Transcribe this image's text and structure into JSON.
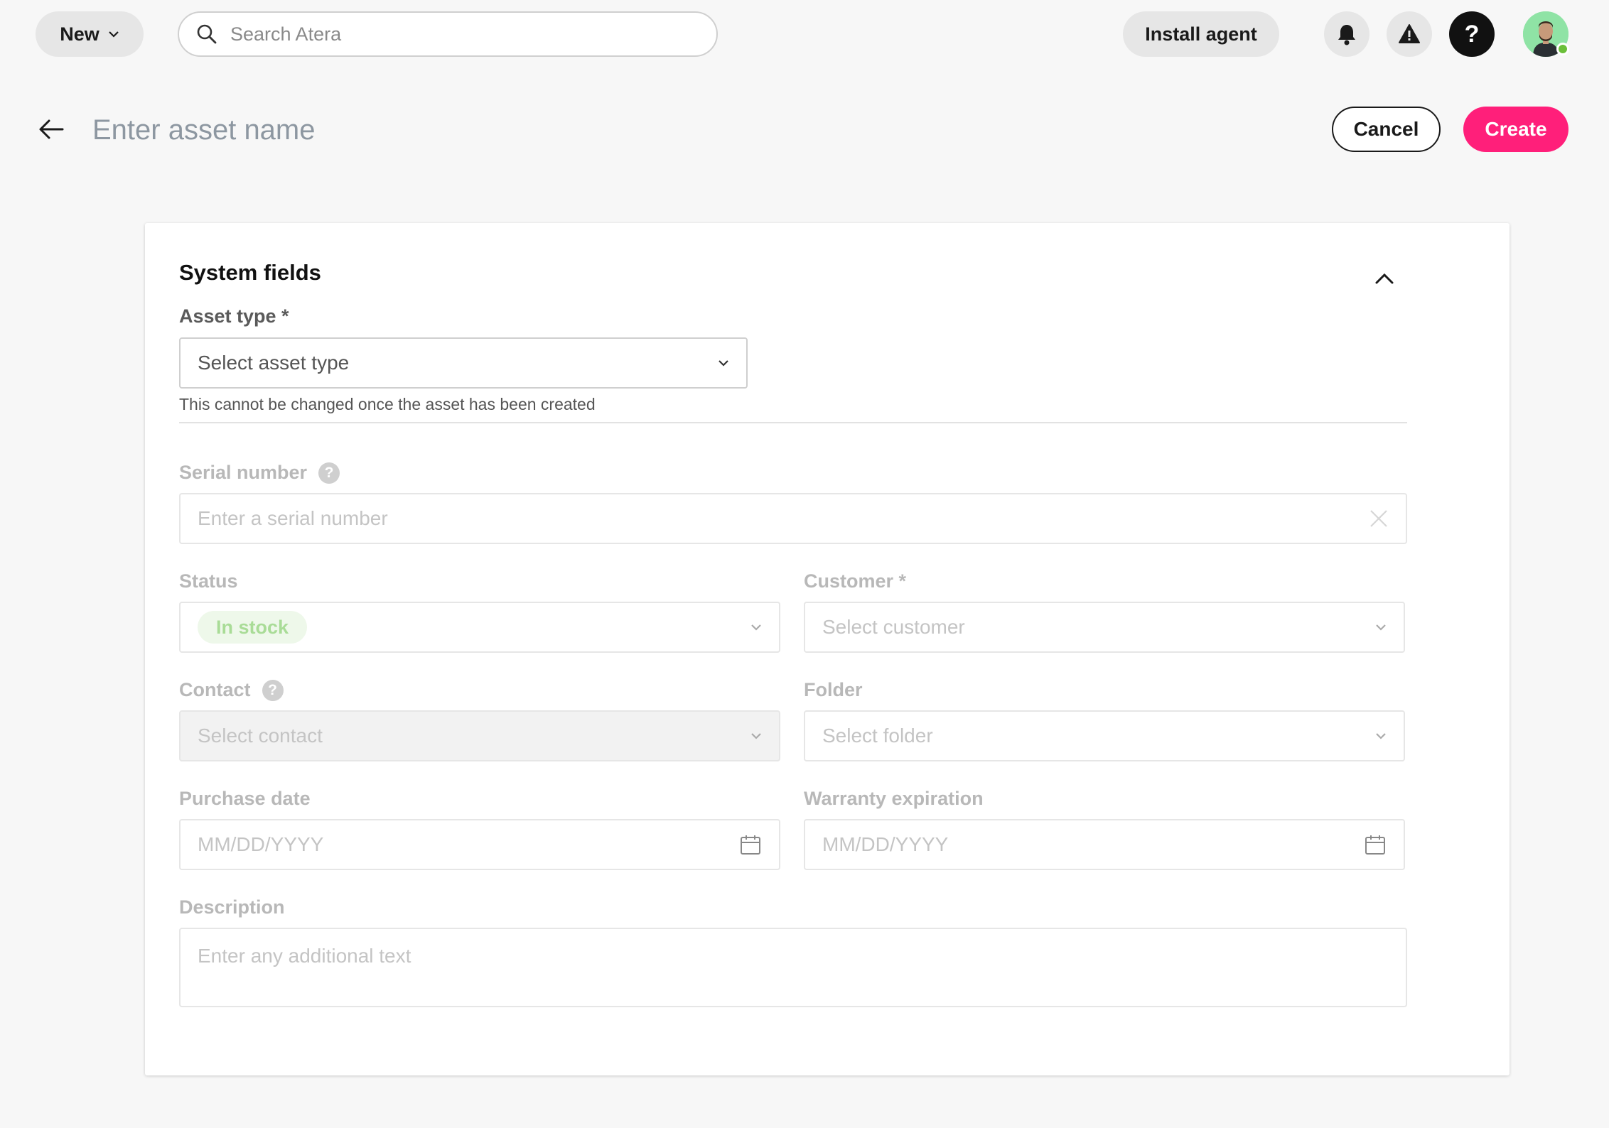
{
  "topbar": {
    "new_label": "New",
    "search_placeholder": "Search Atera",
    "install_label": "Install agent",
    "help_glyph": "?"
  },
  "header": {
    "asset_name_placeholder": "Enter asset name",
    "cancel_label": "Cancel",
    "create_label": "Create"
  },
  "form": {
    "section_title": "System fields",
    "asset_type_label": "Asset type *",
    "asset_type_placeholder": "Select asset type",
    "asset_type_hint": "This cannot be changed once the asset has been created",
    "serial_label": "Serial number",
    "serial_placeholder": "Enter a serial number",
    "status_label": "Status",
    "status_value": "In stock",
    "customer_label": "Customer *",
    "customer_placeholder": "Select customer",
    "contact_label": "Contact",
    "contact_placeholder": "Select contact",
    "folder_label": "Folder",
    "folder_placeholder": "Select folder",
    "purchase_label": "Purchase date",
    "purchase_placeholder": "MM/DD/YYYY",
    "warranty_label": "Warranty expiration",
    "warranty_placeholder": "MM/DD/YYYY",
    "description_label": "Description",
    "description_placeholder": "Enter any additional text",
    "help_glyph": "?"
  },
  "colors": {
    "accent": "#ff1f7a",
    "status_in_stock": "#a9dc97"
  },
  "icons": [
    "search-icon",
    "chevron-down-icon",
    "bell-icon",
    "warning-icon",
    "help-icon",
    "back-arrow-icon",
    "chevron-up-icon",
    "clear-icon",
    "calendar-icon"
  ]
}
